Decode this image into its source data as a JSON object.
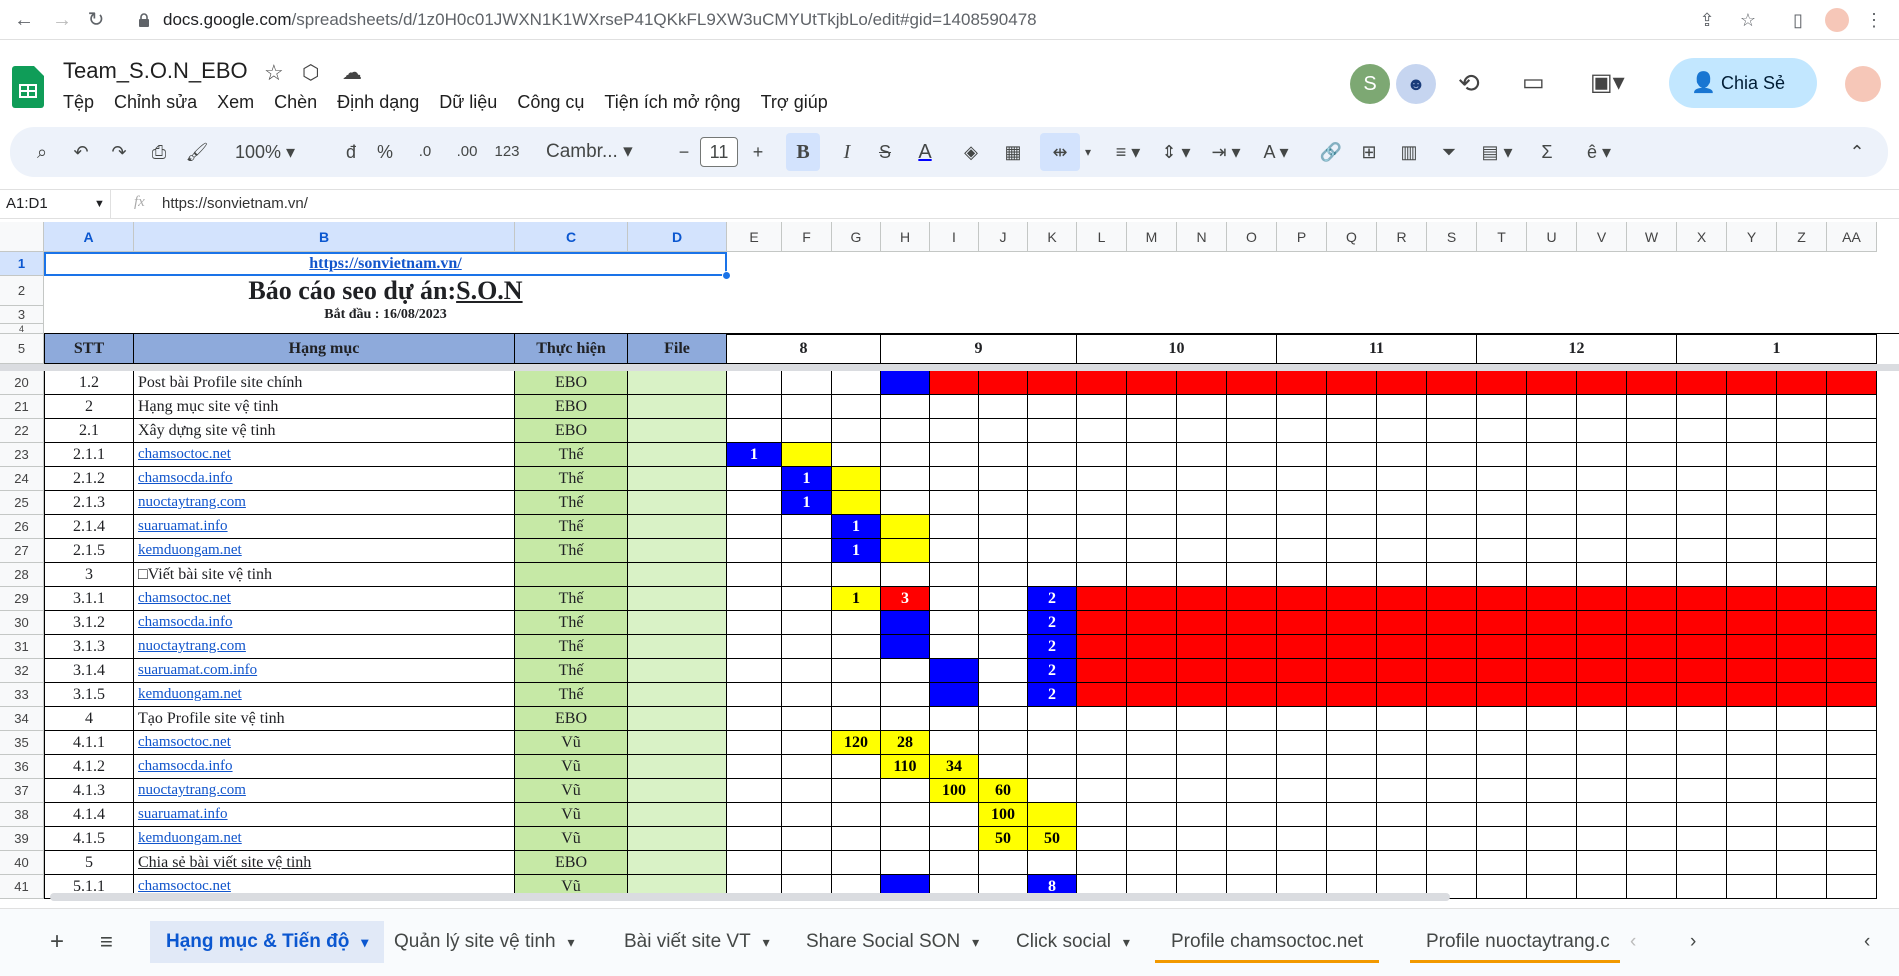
{
  "browser": {
    "url_host": "docs.google.com",
    "url_path": "/spreadsheets/d/1z0H0c01JWXN1K1WXrseP41QKkFL9XW3uCMYUtTkjbLo/edit#gid=1408590478"
  },
  "doc": {
    "title": "Team_S.O.N_EBO",
    "menu": [
      "Tệp",
      "Chỉnh sửa",
      "Xem",
      "Chèn",
      "Định dạng",
      "Dữ liệu",
      "Công cụ",
      "Tiện ích mở rộng",
      "Trợ giúp"
    ],
    "avatar_letter": "S",
    "share_label": "Chia Sẻ"
  },
  "toolbar": {
    "zoom": "100%",
    "currency": "đ",
    "percent": "%",
    "dec_less": ".0",
    "dec_more": ".00",
    "num_format": "123",
    "font": "Cambr...",
    "font_size": "11"
  },
  "formula_bar": {
    "name_box": "A1:D1",
    "fx": "fx",
    "content": "https://sonvietnam.vn/"
  },
  "columns": [
    "A",
    "B",
    "C",
    "D",
    "E",
    "F",
    "G",
    "H",
    "I",
    "J",
    "K",
    "L",
    "M",
    "N",
    "O",
    "P",
    "Q",
    "R",
    "S",
    "T",
    "U",
    "V",
    "W",
    "X",
    "Y",
    "Z",
    "AA"
  ],
  "header_rows": {
    "r1_link": "https://sonvietnam.vn/",
    "r2_title_prefix": "Báo cáo seo dự án: ",
    "r2_title_project": "S.O.N",
    "r3_start": "Bắt đầu : 16/08/2023",
    "stt": "STT",
    "hang_muc": "Hạng mục",
    "thuc_hien": "Thực hiện",
    "file": "File",
    "months": [
      "8",
      "9",
      "10",
      "11",
      "12",
      "1"
    ]
  },
  "row_numbers": [
    "1",
    "2",
    "3",
    "4",
    "5",
    "20",
    "21",
    "22",
    "23",
    "24",
    "25",
    "26",
    "27",
    "28",
    "29",
    "30",
    "31",
    "32",
    "33",
    "34",
    "35",
    "36",
    "37",
    "38",
    "39",
    "40",
    "41"
  ],
  "rows": [
    {
      "n": "20",
      "stt": "1.2",
      "item": "Post bài Profile site chính",
      "link": false,
      "who": "EBO"
    },
    {
      "n": "21",
      "stt": "2",
      "item": "Hạng mục site vệ tinh",
      "link": false,
      "who": "EBO"
    },
    {
      "n": "22",
      "stt": "2.1",
      "item": "Xây dựng site vệ tinh",
      "link": false,
      "who": "EBO"
    },
    {
      "n": "23",
      "stt": "2.1.1",
      "item": "chamsoctoc.net",
      "link": true,
      "who": "Thế"
    },
    {
      "n": "24",
      "stt": "2.1.2",
      "item": "chamsocda.info",
      "link": true,
      "who": "Thế"
    },
    {
      "n": "25",
      "stt": "2.1.3",
      "item": "nuoctaytrang.com",
      "link": true,
      "who": "Thế"
    },
    {
      "n": "26",
      "stt": "2.1.4",
      "item": "suaruamat.info",
      "link": true,
      "who": "Thế"
    },
    {
      "n": "27",
      "stt": "2.1.5",
      "item": "kemduongam.net",
      "link": true,
      "who": "Thế"
    },
    {
      "n": "28",
      "stt": "3",
      "item": "□Viết bài site vệ tinh",
      "link": false,
      "who": ""
    },
    {
      "n": "29",
      "stt": "3.1.1",
      "item": "chamsoctoc.net",
      "link": true,
      "who": "Thế"
    },
    {
      "n": "30",
      "stt": "3.1.2",
      "item": "chamsocda.info",
      "link": true,
      "who": "Thế"
    },
    {
      "n": "31",
      "stt": "3.1.3",
      "item": "nuoctaytrang.com",
      "link": true,
      "who": "Thế"
    },
    {
      "n": "32",
      "stt": "3.1.4",
      "item": "suaruamat.com.info",
      "link": true,
      "who": "Thế"
    },
    {
      "n": "33",
      "stt": "3.1.5",
      "item": "kemduongam.net",
      "link": true,
      "who": "Thế"
    },
    {
      "n": "34",
      "stt": "4",
      "item": "Tạo Profile site vệ tinh",
      "link": false,
      "who": "EBO"
    },
    {
      "n": "35",
      "stt": "4.1.1",
      "item": "chamsoctoc.net",
      "link": true,
      "who": "Vũ"
    },
    {
      "n": "36",
      "stt": "4.1.2",
      "item": "chamsocda.info",
      "link": true,
      "who": "Vũ"
    },
    {
      "n": "37",
      "stt": "4.1.3",
      "item": "nuoctaytrang.com",
      "link": true,
      "who": "Vũ"
    },
    {
      "n": "38",
      "stt": "4.1.4",
      "item": "suaruamat.info",
      "link": true,
      "who": "Vũ"
    },
    {
      "n": "39",
      "stt": "4.1.5",
      "item": "kemduongam.net",
      "link": true,
      "who": "Vũ"
    },
    {
      "n": "40",
      "stt": "5",
      "item": "Chia sẻ bài viết site vệ tinh",
      "link": false,
      "underline": true,
      "who": "EBO"
    },
    {
      "n": "41",
      "stt": "5.1.1",
      "item": "chamsoctoc.net",
      "link": true,
      "who": "Vũ"
    }
  ],
  "gantt": [
    {
      "row": 0,
      "col": "H",
      "color": "#0000ff",
      "text": ""
    },
    {
      "row": 0,
      "span": [
        "I",
        "AA+"
      ],
      "color": "#ff0000",
      "text": ""
    },
    {
      "row": 3,
      "col": "E",
      "color": "#0000ff",
      "text": "1"
    },
    {
      "row": 3,
      "col": "F",
      "color": "#ffff00",
      "text": ""
    },
    {
      "row": 4,
      "col": "F",
      "color": "#0000ff",
      "text": "1"
    },
    {
      "row": 4,
      "col": "G",
      "color": "#ffff00",
      "text": ""
    },
    {
      "row": 5,
      "col": "F",
      "color": "#0000ff",
      "text": "1"
    },
    {
      "row": 5,
      "col": "G",
      "color": "#ffff00",
      "text": ""
    },
    {
      "row": 6,
      "col": "G",
      "color": "#0000ff",
      "text": "1"
    },
    {
      "row": 6,
      "col": "H",
      "color": "#ffff00",
      "text": ""
    },
    {
      "row": 7,
      "col": "G",
      "color": "#0000ff",
      "text": "1"
    },
    {
      "row": 7,
      "col": "H",
      "color": "#ffff00",
      "text": ""
    },
    {
      "row": 9,
      "col": "G",
      "color": "#ffff00",
      "text": "1"
    },
    {
      "row": 9,
      "col": "H",
      "color": "#ff0000",
      "text": "3"
    },
    {
      "row": 9,
      "col": "K",
      "color": "#0000ff",
      "text": "2"
    },
    {
      "row": 9,
      "span": [
        "L",
        "AA+"
      ],
      "color": "#ff0000",
      "text": ""
    },
    {
      "row": 10,
      "col": "H",
      "color": "#0000ff",
      "text": ""
    },
    {
      "row": 10,
      "col": "K",
      "color": "#0000ff",
      "text": "2"
    },
    {
      "row": 10,
      "span": [
        "L",
        "AA+"
      ],
      "color": "#ff0000",
      "text": ""
    },
    {
      "row": 11,
      "col": "H",
      "color": "#0000ff",
      "text": ""
    },
    {
      "row": 11,
      "col": "K",
      "color": "#0000ff",
      "text": "2"
    },
    {
      "row": 11,
      "span": [
        "L",
        "AA+"
      ],
      "color": "#ff0000",
      "text": ""
    },
    {
      "row": 12,
      "col": "I",
      "color": "#0000ff",
      "text": ""
    },
    {
      "row": 12,
      "col": "K",
      "color": "#0000ff",
      "text": "2"
    },
    {
      "row": 12,
      "span": [
        "L",
        "AA+"
      ],
      "color": "#ff0000",
      "text": ""
    },
    {
      "row": 13,
      "col": "I",
      "color": "#0000ff",
      "text": ""
    },
    {
      "row": 13,
      "col": "K",
      "color": "#0000ff",
      "text": "2"
    },
    {
      "row": 13,
      "span": [
        "L",
        "AA+"
      ],
      "color": "#ff0000",
      "text": ""
    },
    {
      "row": 15,
      "col": "G",
      "color": "#ffff00",
      "text": "120"
    },
    {
      "row": 15,
      "col": "H",
      "color": "#ffff00",
      "text": "28"
    },
    {
      "row": 16,
      "col": "H",
      "color": "#ffff00",
      "text": "110"
    },
    {
      "row": 16,
      "col": "I",
      "color": "#ffff00",
      "text": "34"
    },
    {
      "row": 17,
      "col": "I",
      "color": "#ffff00",
      "text": "100"
    },
    {
      "row": 17,
      "col": "J",
      "color": "#ffff00",
      "text": "60"
    },
    {
      "row": 18,
      "col": "J",
      "color": "#ffff00",
      "text": "100"
    },
    {
      "row": 18,
      "col": "K",
      "color": "#ffff00",
      "text": ""
    },
    {
      "row": 19,
      "col": "J",
      "color": "#ffff00",
      "text": "50"
    },
    {
      "row": 19,
      "col": "K",
      "color": "#ffff00",
      "text": "50"
    },
    {
      "row": 21,
      "col": "H",
      "color": "#0000ff",
      "text": ""
    },
    {
      "row": 21,
      "col": "K",
      "color": "#0000ff",
      "text": "8"
    }
  ],
  "sheet_tabs": [
    "Hạng mục & Tiến độ",
    "Quản lý site vệ tinh",
    "Bài viết site VT",
    "Share Social SON",
    "Click social",
    "Profile chamsoctoc.net",
    "Profile nuoctaytrang.c"
  ],
  "colors": {
    "header_blue": "#8eaadb",
    "file_green": "#d9f2c6",
    "thuc_green": "#c6e9a6"
  }
}
